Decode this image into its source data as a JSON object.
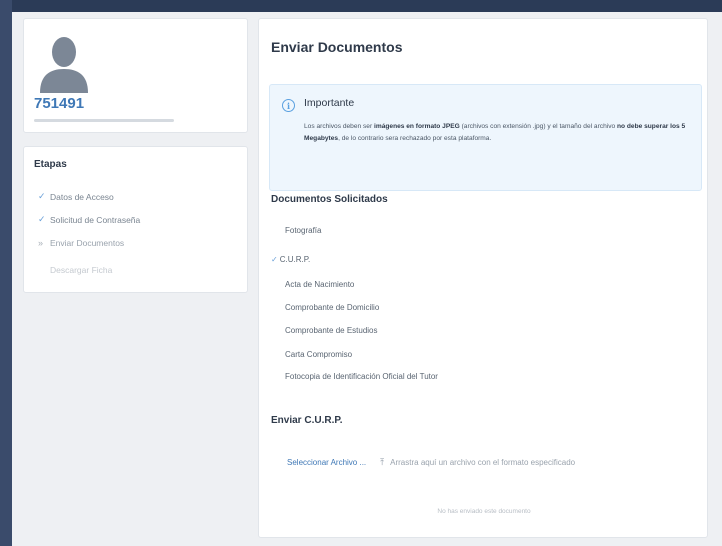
{
  "profile": {
    "user_id": "751491"
  },
  "stages": {
    "title": "Etapas",
    "items": [
      {
        "mark": "✓",
        "label": "Datos de Acceso"
      },
      {
        "mark": "✓",
        "label": "Solicitud de Contraseña"
      },
      {
        "mark": "»",
        "label": "Enviar Documentos"
      },
      {
        "mark": "",
        "label": "Descargar Ficha"
      }
    ]
  },
  "main": {
    "title": "Enviar Documentos",
    "notice": {
      "icon": "info-icon",
      "title": "Importante",
      "text_1": "Los archivos deben ser ",
      "text_bold_1": "imágenes en formato JPEG",
      "text_2": " (archivos con extensión .jpg) y el tamaño del archivo ",
      "text_bold_2": "no debe superar los 5 Megabytes",
      "text_3": ", de lo contrario sera rechazado por esta plataforma."
    },
    "requested_title": "Documentos Solicitados",
    "documents": [
      {
        "check": "",
        "label": "Fotografía"
      },
      {
        "check": "✓",
        "label": "C.U.R.P."
      },
      {
        "check": "",
        "label": "Acta de Nacimiento"
      },
      {
        "check": "",
        "label": "Comprobante de Domicilio"
      },
      {
        "check": "",
        "label": "Comprobante de Estudios"
      },
      {
        "check": "",
        "label": "Carta Compromiso"
      },
      {
        "check": "",
        "label": "Fotocopia de Identificación Oficial del Tutor"
      }
    ],
    "upload": {
      "title": "Enviar C.U.R.P.",
      "select_label": "Seleccionar Archivo ...",
      "upload_icon": "upload-icon",
      "drop_text": "Arrastra aquí un archivo con el formato especificado",
      "status": "No has enviado este documento"
    }
  },
  "colors": {
    "accent": "#3f78b6",
    "check": "#6aa0d8",
    "topbar": "#2b3b57",
    "notice_bg": "#eef6fd"
  }
}
